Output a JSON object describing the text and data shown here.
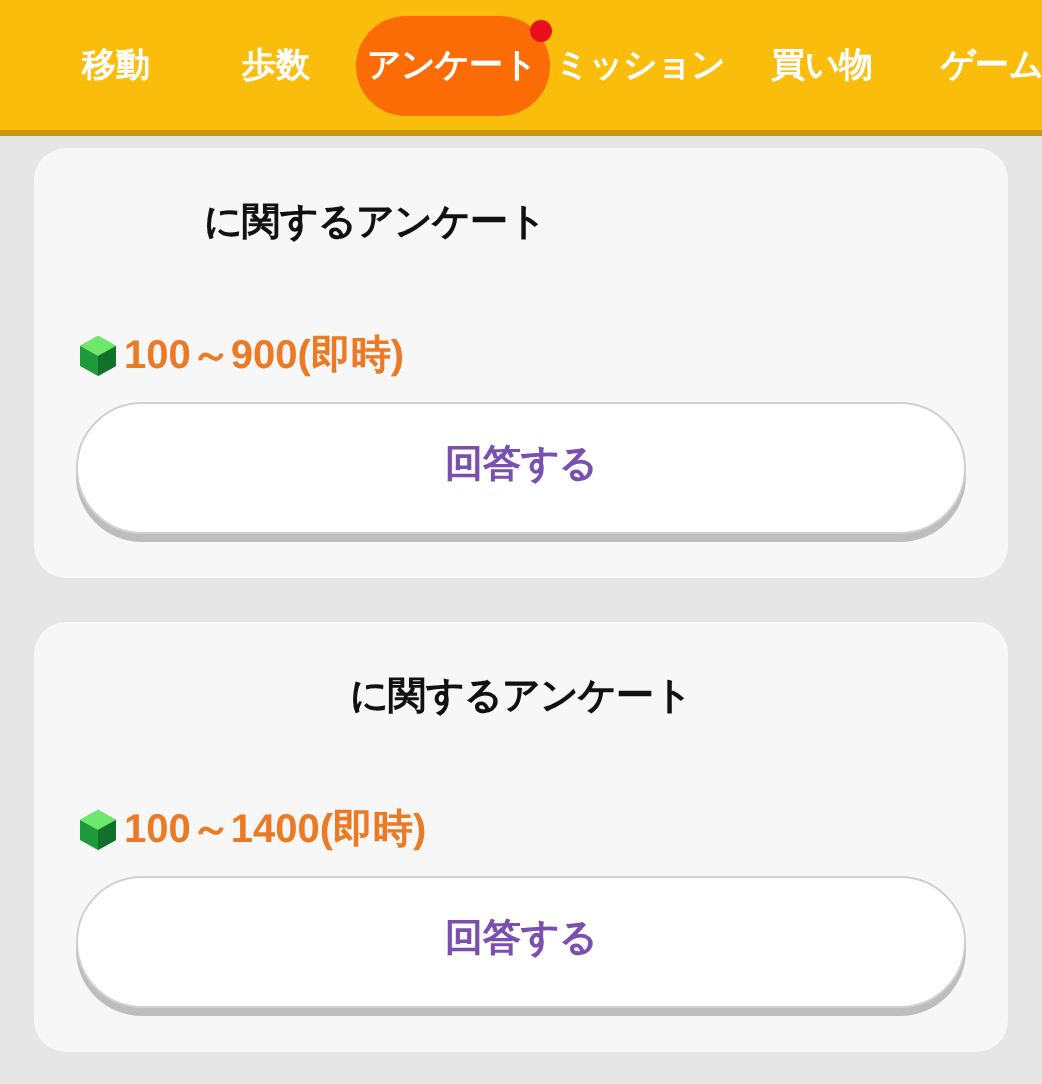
{
  "tabs": [
    {
      "label": "移動",
      "selected": false,
      "badge": false
    },
    {
      "label": "歩数",
      "selected": false,
      "badge": false
    },
    {
      "label": "アンケート",
      "selected": true,
      "badge": true
    },
    {
      "label": "ミッション",
      "selected": false,
      "badge": false
    },
    {
      "label": "買い物",
      "selected": false,
      "badge": false
    },
    {
      "label": "ゲーム",
      "selected": false,
      "badge": false
    }
  ],
  "surveys": [
    {
      "title": "に関するアンケート",
      "reward": "100～900(即時)",
      "button": "回答する"
    },
    {
      "title": "に関するアンケート",
      "reward": "100～1400(即時)",
      "button": "回答する"
    }
  ]
}
